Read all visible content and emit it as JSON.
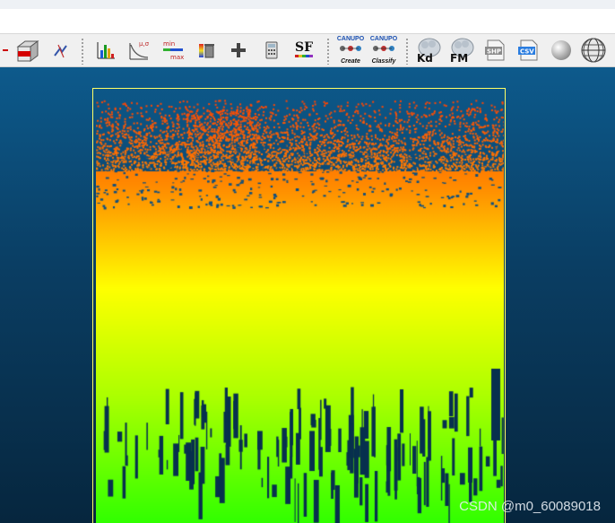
{
  "window": {
    "top_strip": "",
    "blank_bar": ""
  },
  "toolbar": {
    "sf_label": "SF",
    "canupo_create_top": "CANUPO",
    "canupo_create_bottom": "Create",
    "canupo_classify_top": "CANUPO",
    "canupo_classify_bottom": "Classify",
    "kd_label": "Kd",
    "fm_label": "FM",
    "shp_label": "SHP",
    "csv_label": "CSV",
    "musigma_label": "μ,σ",
    "min_label": "min",
    "max_label": "max"
  },
  "viewport": {
    "watermark": "CSDN @m0_60089018",
    "cloud_colors": [
      "#ff3a00",
      "#ff8c00",
      "#ffff00",
      "#aaff00",
      "#2aff00"
    ],
    "bbox_color": "#ffff66"
  }
}
